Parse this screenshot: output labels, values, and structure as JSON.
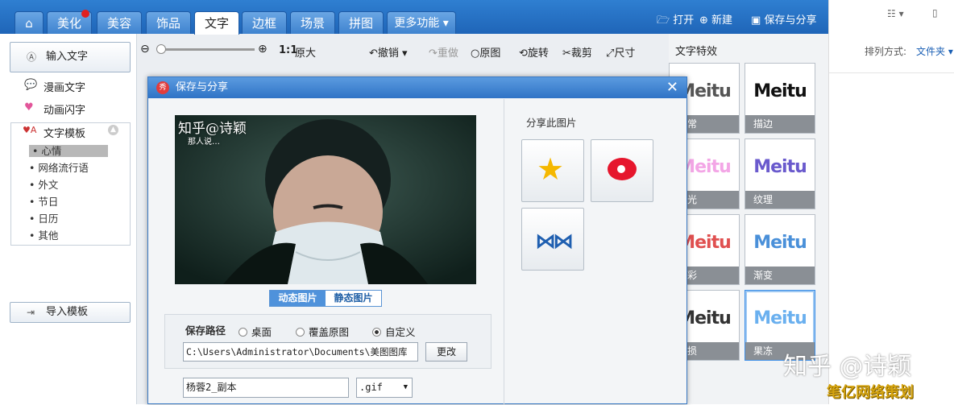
{
  "nav": {
    "tabs": [
      "美化",
      "美容",
      "饰品",
      "文字",
      "边框",
      "场景",
      "拼图",
      "更多功能 ▾"
    ],
    "active_tab": "文字"
  },
  "topright": {
    "open": "打开",
    "new": "新建",
    "save_share": "保存与分享"
  },
  "explorer": {
    "sort_label": "排列方式:",
    "sort_value": "文件夹 ▾"
  },
  "sidebar": {
    "input_text": "输入文字",
    "comic_text": "漫画文字",
    "flash_text": "动画闪字",
    "template": "文字模板",
    "categories": [
      "心情",
      "网络流行语",
      "外文",
      "节日",
      "日历",
      "其他"
    ],
    "import_template": "导入模板"
  },
  "toolbar": {
    "ratio": "1:1",
    "original_size": "原大",
    "undo": "撤销",
    "redo": "重做",
    "original": "原图",
    "rotate": "旋转",
    "crop": "裁剪",
    "size": "尺寸"
  },
  "effects": {
    "title": "文字特效",
    "items": [
      {
        "label": "正常",
        "logo": "Meitu",
        "color": "#555555"
      },
      {
        "label": "描边",
        "logo": "Meitu",
        "color": "#111111"
      },
      {
        "label": "荧光",
        "logo": "Meitu",
        "color": "#f3a6e6"
      },
      {
        "label": "纹理",
        "logo": "Meitu",
        "color": "#6a5acd"
      },
      {
        "label": "多彩",
        "logo": "Meitu",
        "color": "#e05050"
      },
      {
        "label": "渐变",
        "logo": "Meitu",
        "color": "#4a90d9"
      },
      {
        "label": "破损",
        "logo": "Meitu",
        "color": "#333333"
      },
      {
        "label": "果冻",
        "logo": "Meitu",
        "color": "#6ab0ef"
      }
    ]
  },
  "dialog": {
    "title": "保存与分享",
    "photo_watermark": "知乎@诗颖",
    "photo_caption": "那人说…",
    "tab_animated": "动态图片",
    "tab_static": "静态图片",
    "share_title": "分享此图片",
    "save_path_label": "保存路径",
    "radio_desktop": "桌面",
    "radio_overwrite": "覆盖原图",
    "radio_custom": "自定义",
    "path_value": "C:\\Users\\Administrator\\Documents\\美图图库",
    "change_button": "更改",
    "filename": "杨蓉2_副本",
    "format": ".gif"
  },
  "watermark": {
    "text": "知乎 @诗颖",
    "site": "笔亿网络策划"
  }
}
